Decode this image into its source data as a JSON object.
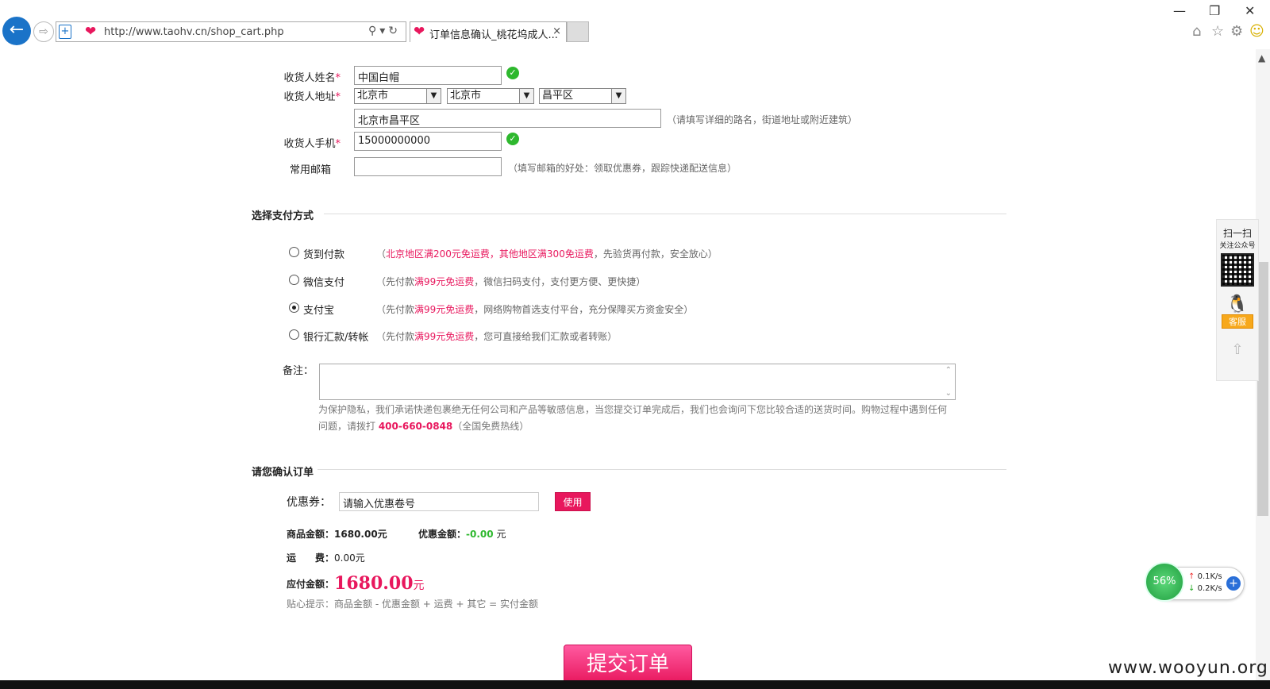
{
  "browser": {
    "url": "http://www.taohv.cn/shop_cart.php",
    "tab_title": "订单信息确认_桃花坞成人...",
    "close_tab": "×"
  },
  "receiver": {
    "name_label": "收货人姓名",
    "name_value": "中国白帽",
    "address_label": "收货人地址",
    "province": "北京市",
    "city": "北京市",
    "district": "昌平区",
    "address_value": "北京市昌平区",
    "address_hint": "（请填写详细的路名，街道地址或附近建筑）",
    "phone_label": "收货人手机",
    "phone_value": "15000000000",
    "email_label": "常用邮箱",
    "email_hint": "（填写邮箱的好处：领取优惠券，跟踪快递配送信息）",
    "required_mark": "*"
  },
  "payment": {
    "title": "选择支付方式",
    "options": [
      {
        "name": "货到付款",
        "pre": "（",
        "pink": "北京地区满200元免运费，其他地区满300免运费",
        "post": "，先验货再付款，安全放心）",
        "selected": false
      },
      {
        "name": "微信支付",
        "pre": "（先付款",
        "pink": "满99元免运费",
        "post": "，微信扫码支付，支付更方便、更快捷）",
        "selected": false
      },
      {
        "name": "支付宝",
        "pre": "（先付款",
        "pink": "满99元免运费",
        "post": "，网络购物首选支付平台，充分保障买方资金安全）",
        "selected": true
      },
      {
        "name": "银行汇款/转帐",
        "pre": "（先付款",
        "pink": "满99元免运费",
        "post": "，您可直接给我们汇款或者转账）",
        "selected": false
      }
    ],
    "remark_label": "备注：",
    "privacy_note_1": "为保护隐私，我们承诺快递包裹绝无任何公司和产品等敏感信息，当您提交订单完成后，我们也会询问下您比较合适的送货时间。购物过程中遇到任何",
    "privacy_note_2a": "问题，请拨打 ",
    "hotline": "400-660-0848",
    "privacy_note_2b": "（全国免费热线）"
  },
  "order": {
    "title": "请您确认订单",
    "coupon_label": "优惠券：",
    "coupon_placeholder": "请输入优惠卷号",
    "use_button": "使用",
    "goods_label": "商品金额：",
    "goods_value": "1680.00元",
    "discount_label": "优惠金额：",
    "discount_value": "-0.00",
    "discount_unit": "元",
    "shipping_label": "运　　费：",
    "shipping_value": "0.00元",
    "payable_label": "应付金额：",
    "payable_value": "1680.00",
    "payable_unit": "元",
    "tip": "贴心提示：商品金额 - 优惠金额 + 运费 + 其它 = 实付金额",
    "submit": "提交订单"
  },
  "float_panel": {
    "scan": "扫一扫",
    "follow": "关注公众号",
    "service": "客服"
  },
  "speed_widget": {
    "percent": "56%",
    "up": "0.1K/s",
    "down": "0.2K/s"
  },
  "watermark": "www.wooyun.org"
}
